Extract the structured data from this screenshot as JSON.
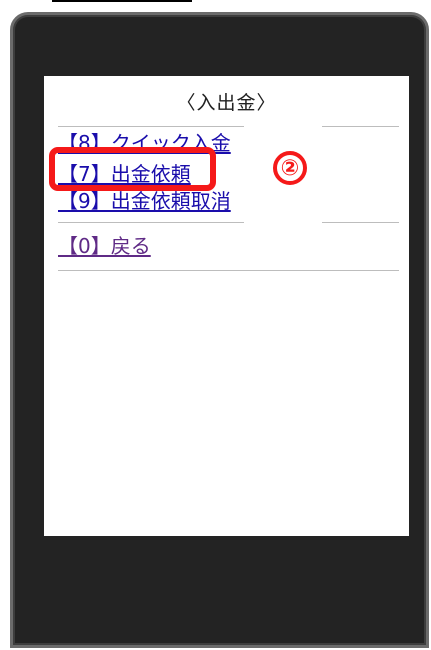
{
  "screen": {
    "title": "〈入出金〉",
    "menu_items": [
      {
        "label": "【8】クイック入金",
        "selected": false
      },
      {
        "label": "【7】出金依頼",
        "selected": true
      },
      {
        "label": "【9】出金依頼取消",
        "selected": false
      },
      {
        "label": "【0】戻る",
        "selected": false
      }
    ]
  },
  "annotation": {
    "marker": "②"
  },
  "colors": {
    "phone_frame": "#232323",
    "phone_border": "#6b6b6b",
    "screen_bg": "#ffffff",
    "link_blue": "#1a0dab",
    "link_visited": "#5f2a86",
    "highlight_red": "#f51919"
  }
}
